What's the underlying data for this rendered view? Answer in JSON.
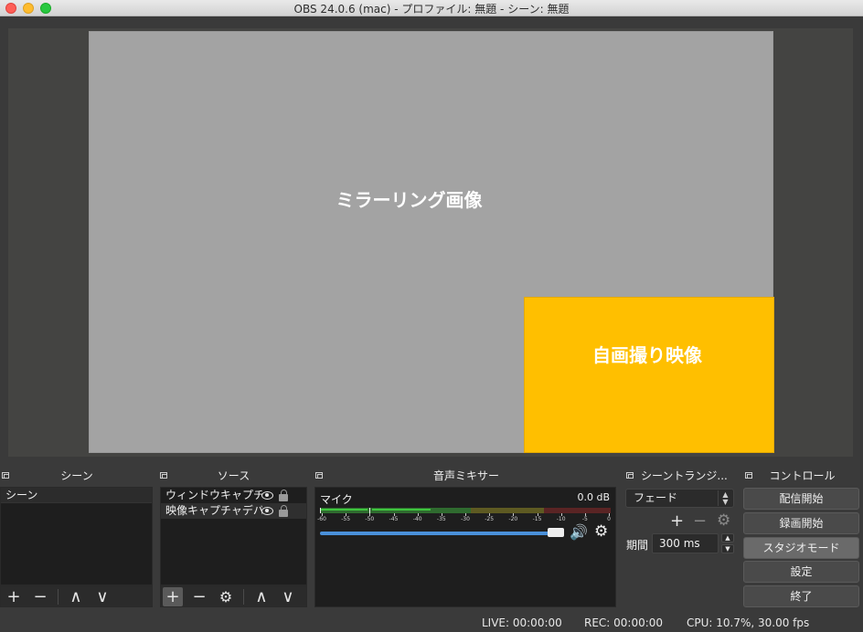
{
  "window": {
    "title": "OBS 24.0.6 (mac) - プロファイル: 無題 - シーン: 無題"
  },
  "preview": {
    "mirror_label": "ミラーリング画像",
    "camera_label": "自画撮り映像"
  },
  "docks": {
    "scenes": {
      "title": "シーン",
      "items": [
        "シーン"
      ]
    },
    "sources": {
      "title": "ソース",
      "items": [
        "ウィンドウキャプチャ",
        "映像キャプチャデバイス"
      ]
    },
    "mixer": {
      "title": "音声ミキサー",
      "channel_name": "マイク",
      "level": "0.0 dB",
      "ticks": [
        "-60",
        "-55",
        "-50",
        "-45",
        "-40",
        "-35",
        "-30",
        "-25",
        "-20",
        "-15",
        "-10",
        "-5",
        "0"
      ],
      "volume_fraction": 0.93
    },
    "transitions": {
      "title": "シーントランジ...",
      "selected": "フェード",
      "duration_label": "期間",
      "duration_value": "300 ms"
    },
    "controls": {
      "title": "コントロール",
      "buttons": [
        "配信開始",
        "録画開始",
        "スタジオモード",
        "設定",
        "終了"
      ]
    }
  },
  "status": {
    "live": "LIVE: 00:00:00",
    "rec": "REC: 00:00:00",
    "cpu": "CPU: 10.7%, 30.00 fps"
  },
  "colors": {
    "mirror": "#a3a3a3",
    "camera": "#ffbf00",
    "volume": "#4a90d9",
    "meter_green": "#3ec63e",
    "meter_yellow": "#c8b33a",
    "meter_red": "#c0392b"
  },
  "icons": {
    "add": "+",
    "remove": "−",
    "up": "∧",
    "down": "∨",
    "gear": "⚙",
    "speaker": "🔊"
  }
}
